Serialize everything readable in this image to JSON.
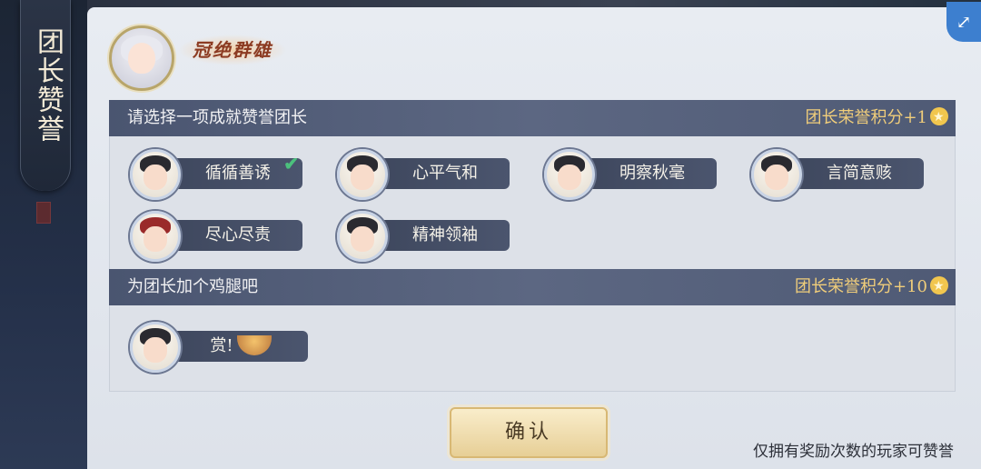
{
  "sidebar": {
    "title": "团长赞誉"
  },
  "header": {
    "title_badge": "冠绝群雄"
  },
  "section1": {
    "label": "请选择一项成就赞誉团长",
    "reward": "团长荣誉积分+1",
    "options": [
      {
        "label": "循循善诱",
        "selected": true
      },
      {
        "label": "心平气和",
        "selected": false
      },
      {
        "label": "明察秋毫",
        "selected": false
      },
      {
        "label": "言简意赅",
        "selected": false
      },
      {
        "label": "尽心尽责",
        "selected": false
      },
      {
        "label": "精神领袖",
        "selected": false
      }
    ]
  },
  "section2": {
    "label": "为团长加个鸡腿吧",
    "reward": "团长荣誉积分+10",
    "option": {
      "label": "赏!"
    }
  },
  "confirm_label": "确认",
  "footer_note": "仅拥有奖励次数的玩家可赞誉",
  "colors": {
    "accent_gold": "#f0cd7a",
    "check_green": "#4cc07d",
    "bar_bg": "#4a5570"
  }
}
